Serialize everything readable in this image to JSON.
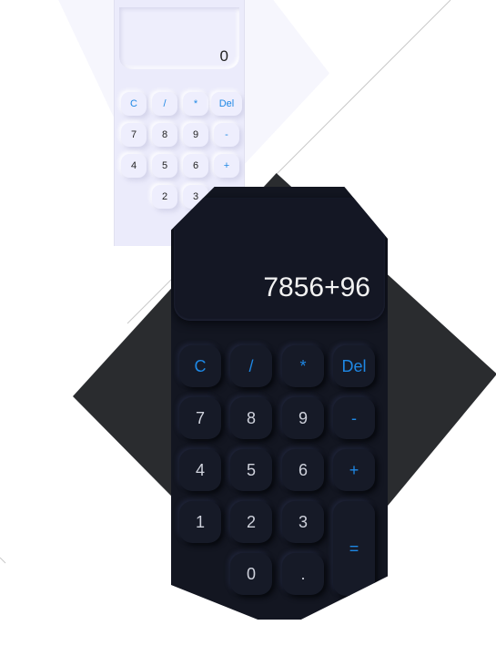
{
  "light_calculator": {
    "display": "0",
    "keys": [
      "C",
      "/",
      "*",
      "Del",
      "7",
      "8",
      "9",
      "-",
      "4",
      "5",
      "6",
      "+",
      "2",
      "3"
    ]
  },
  "dark_calculator": {
    "display": "7856+96",
    "keys": [
      "C",
      "/",
      "*",
      "Del",
      "7",
      "8",
      "9",
      "-",
      "4",
      "5",
      "6",
      "+",
      "1",
      "2",
      "3",
      "=",
      "0",
      "."
    ]
  },
  "colors": {
    "accent": "#1e88e5",
    "light_body": "#ebebfb",
    "dark_body": "#131621",
    "dark_background": "#2a2c2f"
  }
}
